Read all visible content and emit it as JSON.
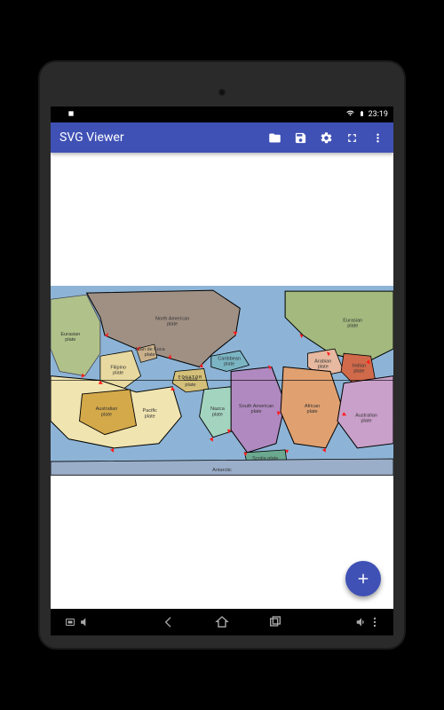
{
  "status": {
    "time": "23:19"
  },
  "app": {
    "title": "SVG Viewer",
    "icons": {
      "folder": "folder-icon",
      "save": "save-icon",
      "settings": "gear-icon",
      "fullscreen": "fullscreen-icon",
      "overflow": "more-icon"
    }
  },
  "map": {
    "equator_label": "EQUATOR",
    "plates": {
      "eurasian_left": "Eurasian\nplate",
      "north_american": "North American\nplate",
      "juan_de_fuca": "Juan de Fuca\nplate",
      "caribbean": "Caribbean\nplate",
      "eurasian_right": "Eurasian\nplate",
      "filipino": "Filipino\nplate",
      "arabian": "Arabian\nplate",
      "indian": "Indian\nplate",
      "cocos": "Cocos\nplate",
      "pacific": "Pacific\nplate",
      "australian_left": "Australian\nplate",
      "nazca": "Nazca\nplate",
      "south_american": "South American\nplate",
      "african": "African\nplate",
      "australian_right": "Australian\nplate",
      "scotia": "Scotia plate",
      "antarctic": "Antarctic"
    }
  },
  "fab": {
    "label": "+"
  },
  "colors": {
    "primary": "#3f51b5",
    "ocean": "#8db4d6",
    "land": "#a09084"
  }
}
